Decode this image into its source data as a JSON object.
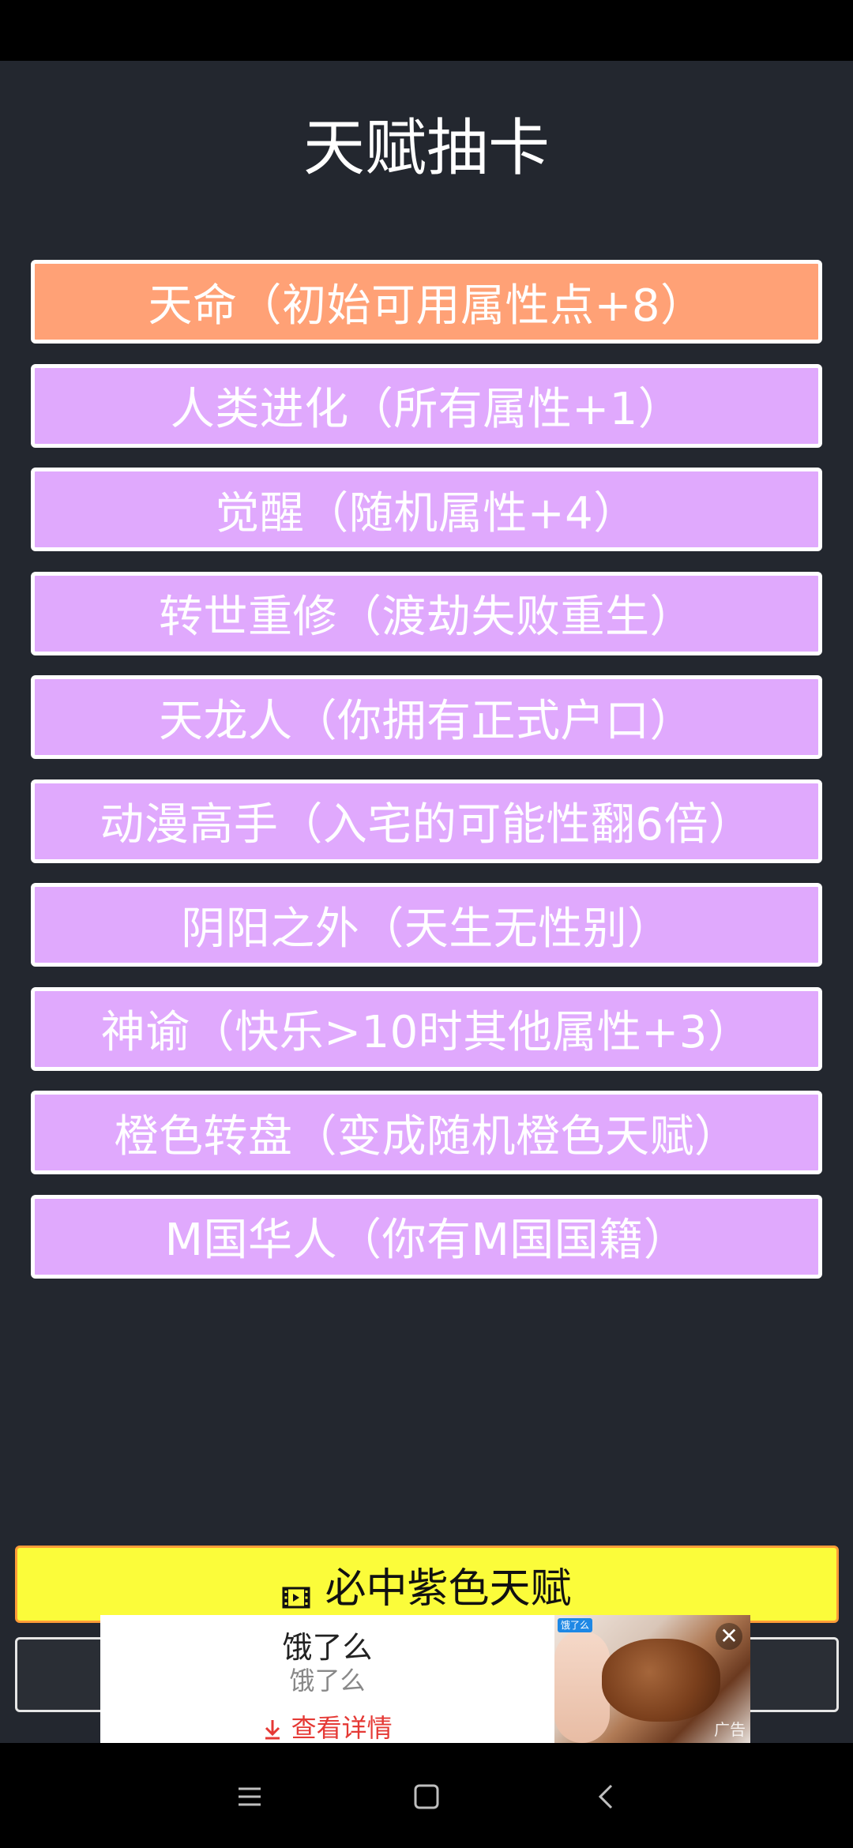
{
  "title": "天赋抽卡",
  "talents": [
    {
      "label": "天命（初始可用属性点+8）"
    },
    {
      "label": "人类进化（所有属性+1）"
    },
    {
      "label": "觉醒（随机属性+4）"
    },
    {
      "label": "转世重修（渡劫失败重生）"
    },
    {
      "label": "天龙人（你拥有正式户口）"
    },
    {
      "label": "动漫高手（入宅的可能性翻6倍）"
    },
    {
      "label": "阴阳之外（天生无性别）"
    },
    {
      "label": "神谕（快乐>10时其他属性+3）"
    },
    {
      "label": "橙色转盘（变成随机橙色天赋）"
    },
    {
      "label": "M国华人（你有M国国籍）"
    }
  ],
  "guaranteed_button": {
    "label": "必中紫色天赋",
    "icon": "film-icon"
  },
  "ad": {
    "title": "饿了么",
    "subtitle": "饿了么",
    "link": "查看详情",
    "link_icon": "download-arrow-icon",
    "badge": "饿了么",
    "close": "✕",
    "watermark": "广告"
  },
  "nav": {
    "icons": [
      "menu-icon",
      "home-icon",
      "back-icon"
    ]
  },
  "colors": {
    "background": "#23272f",
    "orange": "#ffa176",
    "purple": "#e0a9fd",
    "yellow": "#fbfc3a",
    "ad_link": "#e53935"
  }
}
